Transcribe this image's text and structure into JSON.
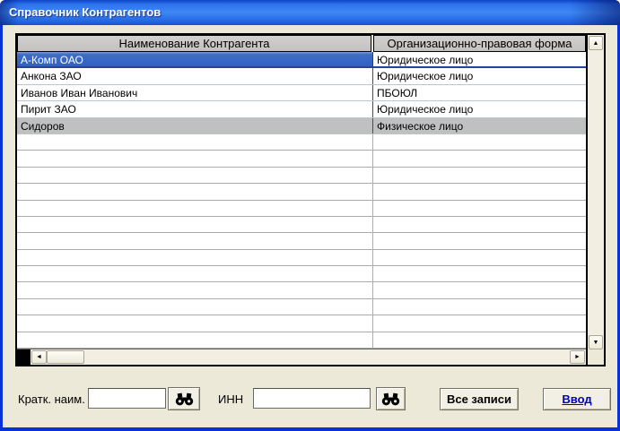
{
  "window": {
    "title": "Справочник Контрагентов"
  },
  "table": {
    "columns": [
      {
        "label": "Наименование Контрагента"
      },
      {
        "label": "Организационно-правовая форма"
      }
    ],
    "rows": [
      {
        "name": "А-Комп ОАО",
        "form": "Юридическое лицо",
        "state": "selected"
      },
      {
        "name": "Анкона ЗАО",
        "form": "Юридическое лицо",
        "state": "normal"
      },
      {
        "name": "Иванов Иван Иванович",
        "form": "ПБОЮЛ",
        "state": "normal"
      },
      {
        "name": "Пирит ЗАО",
        "form": "Юридическое лицо",
        "state": "normal"
      },
      {
        "name": "Сидоров",
        "form": "Физическое лицо",
        "state": "highlighted"
      }
    ],
    "empty_row_count": 13
  },
  "scrollbars": {
    "up_glyph": "▲",
    "down_glyph": "▼",
    "left_glyph": "◄",
    "right_glyph": "►"
  },
  "footer": {
    "short_name_label": "Кратк. наим.",
    "short_name_value": "",
    "inn_label": "ИНН",
    "inn_value": "",
    "all_records_button_label": "Все записи",
    "enter_button_label": "Ввод"
  },
  "colors": {
    "titlebar_blue": "#2E74EE",
    "window_border": "#0831D9",
    "body_background": "#ECE9D8",
    "header_gray": "#C6C4C2",
    "selected_row_blue": "#3162C2",
    "highlighted_row_gray": "#C0C0C0",
    "enter_link_blue": "#0000C8"
  }
}
